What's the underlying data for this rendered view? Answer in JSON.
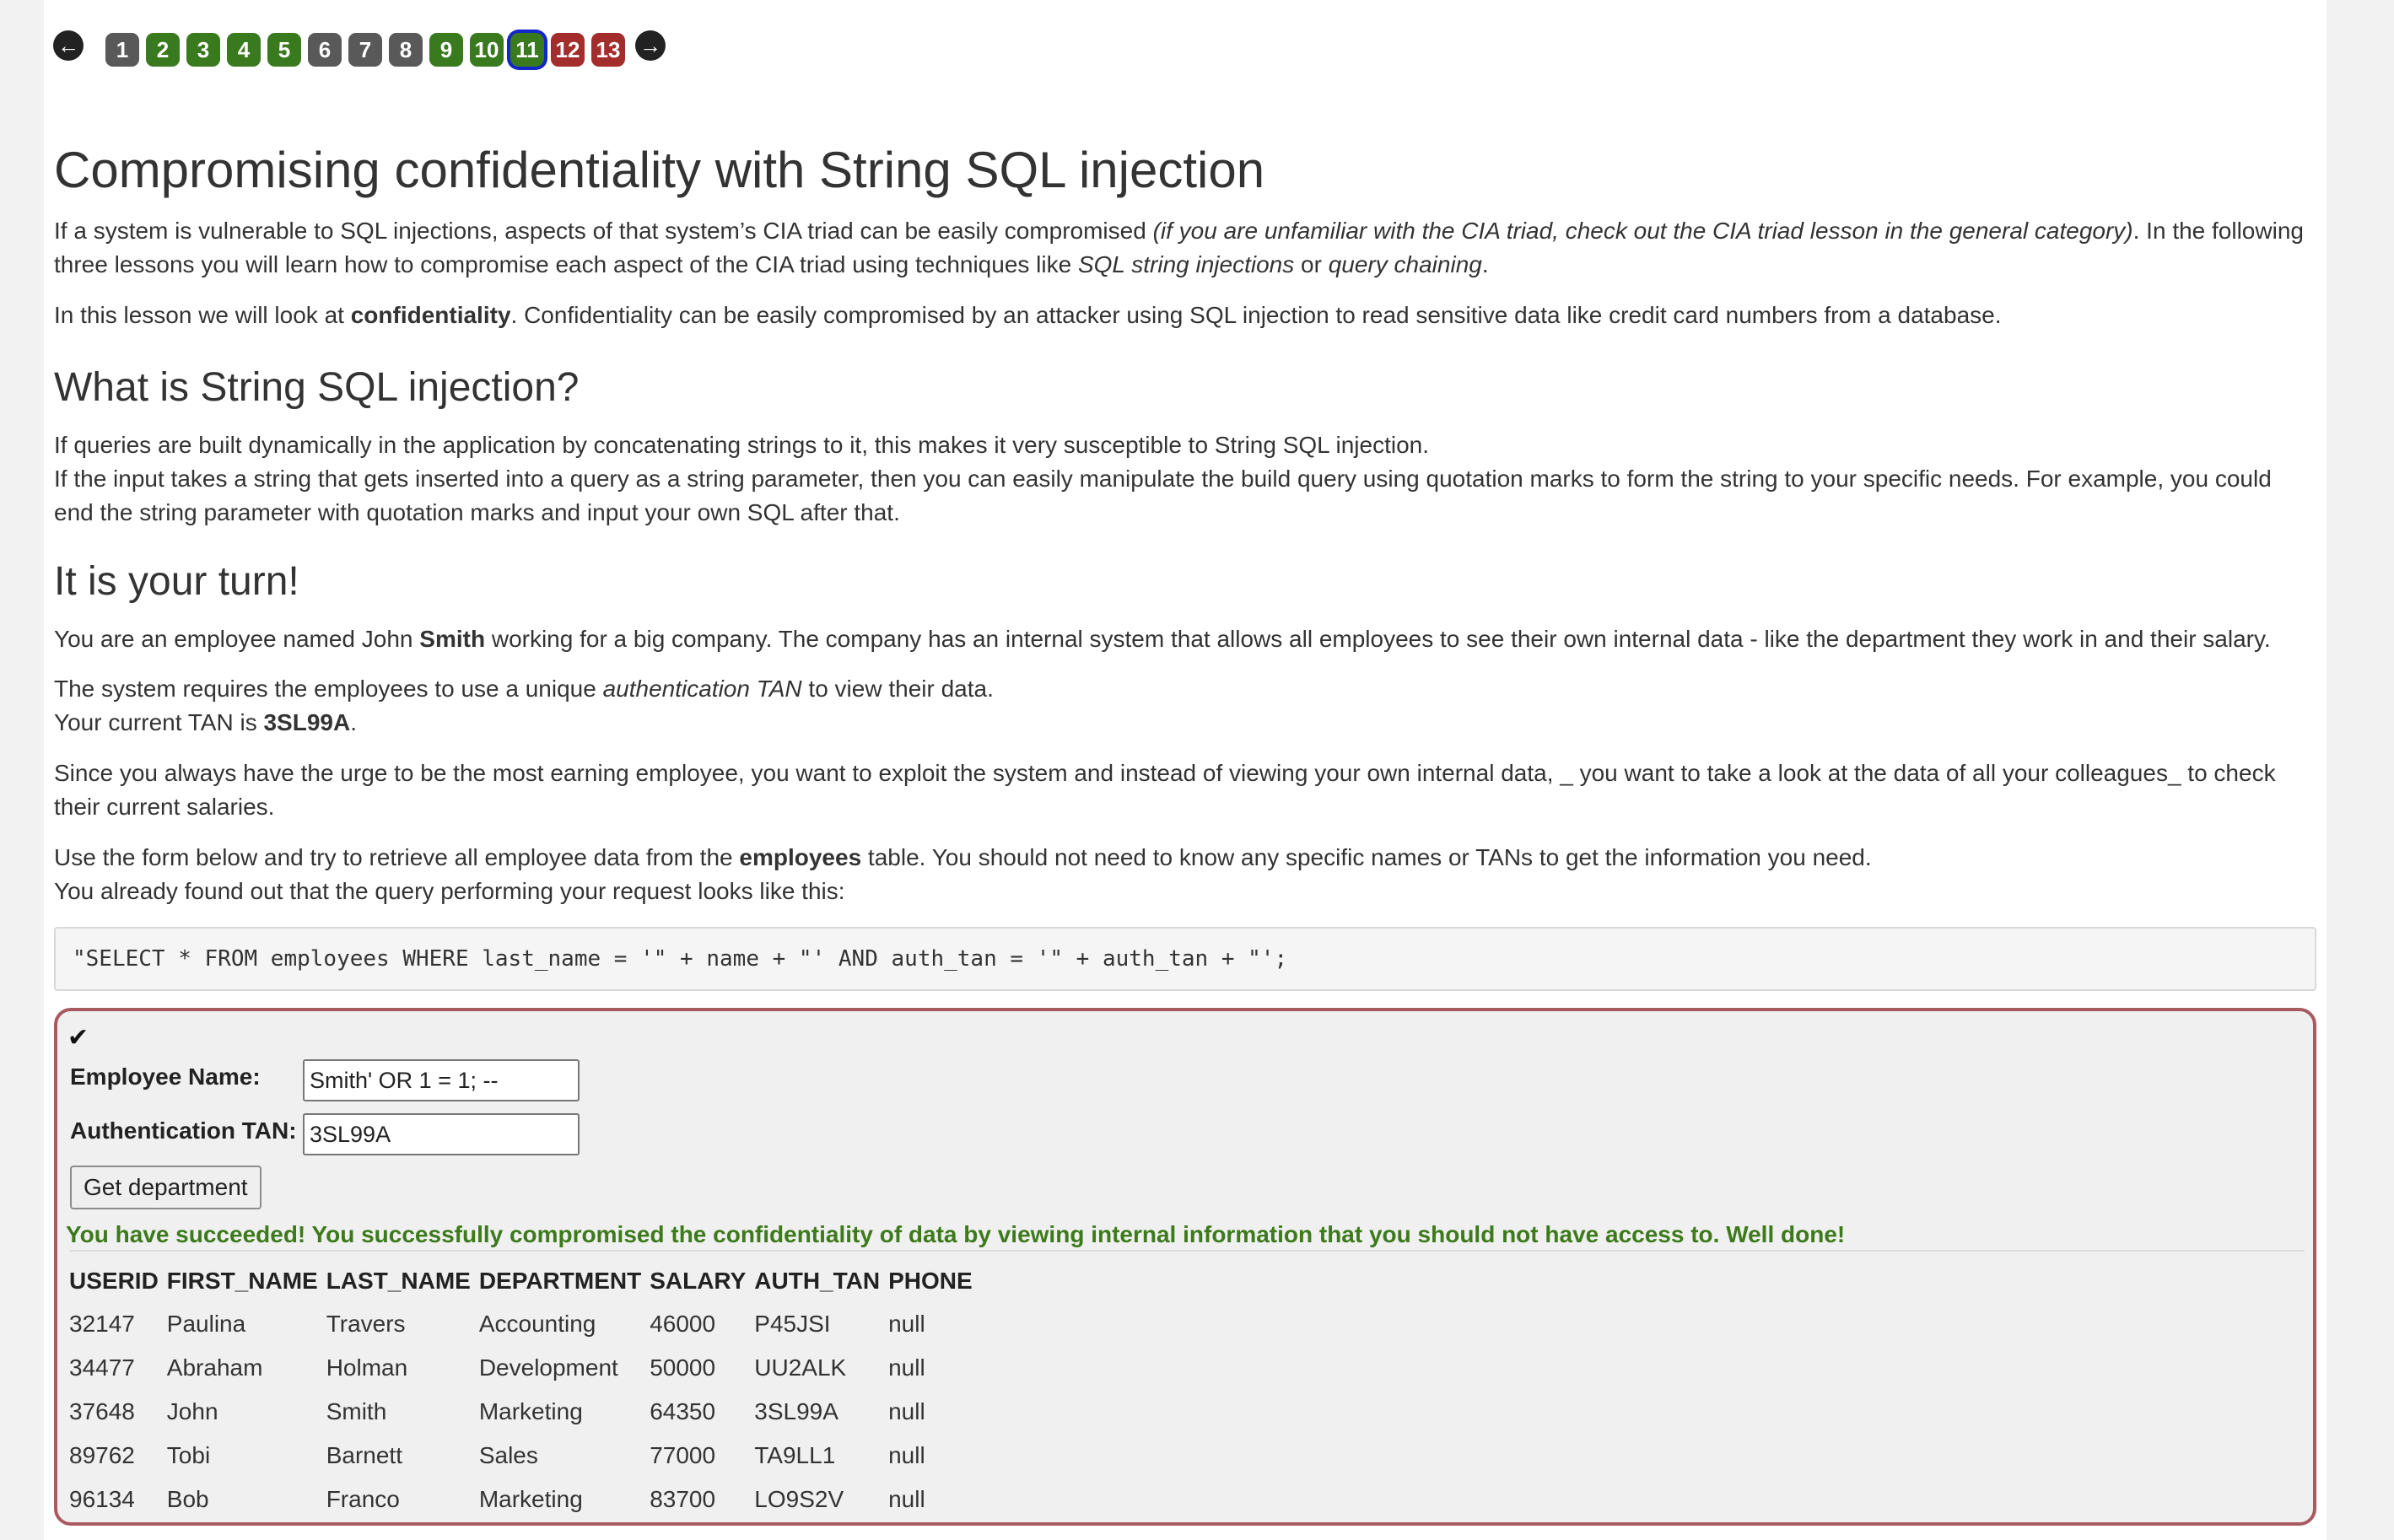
{
  "pager": {
    "prev_icon": "arrow-circle-left-icon",
    "next_icon": "arrow-circle-right-icon",
    "pages": [
      {
        "label": "1",
        "status": "gray"
      },
      {
        "label": "2",
        "status": "green"
      },
      {
        "label": "3",
        "status": "green"
      },
      {
        "label": "4",
        "status": "green"
      },
      {
        "label": "5",
        "status": "green"
      },
      {
        "label": "6",
        "status": "gray"
      },
      {
        "label": "7",
        "status": "gray"
      },
      {
        "label": "8",
        "status": "gray"
      },
      {
        "label": "9",
        "status": "green"
      },
      {
        "label": "10",
        "status": "green"
      },
      {
        "label": "11",
        "status": "green",
        "current": true
      },
      {
        "label": "12",
        "status": "red"
      },
      {
        "label": "13",
        "status": "red"
      }
    ],
    "colors": {
      "gray": "#595959",
      "green": "#3a7a1f",
      "red": "#a32d2d",
      "current_outline": "#1326c7"
    }
  },
  "lesson": {
    "title": "Compromising confidentiality with String SQL injection",
    "p1_a": "If a system is vulnerable to SQL injections, aspects of that system’s CIA triad can be easily compromised ",
    "p1_i": "(if you are unfamiliar with the CIA triad, check out the CIA triad lesson in the general category)",
    "p1_b": ". In the following three lessons you will learn how to compromise each aspect of the CIA triad using techniques like ",
    "p1_i2": "SQL string injections",
    "p1_c": " or ",
    "p1_i3": "query chaining",
    "p1_d": ".",
    "p2_a": "In this lesson we will look at ",
    "p2_b": "confidentiality",
    "p2_c": ". Confidentiality can be easily compromised by an attacker using SQL injection to read sensitive data like credit card numbers from a database.",
    "h2_what": "What is String SQL injection?",
    "p3_line1": "If queries are built dynamically in the application by concatenating strings to it, this makes it very susceptible to String SQL injection.",
    "p3_line2": "If the input takes a string that gets inserted into a query as a string parameter, then you can easily manipulate the build query using quotation marks to form the string to your specific needs. For example, you could end the string parameter with quotation marks and input your own SQL after that.",
    "h2_turn": "It is your turn!",
    "p4_a": "You are an employee named John ",
    "p4_b": "Smith",
    "p4_c": " working for a big company. The company has an internal system that allows all employees to see their own internal data - like the department they work in and their salary.",
    "p5_a": "The system requires the employees to use a unique ",
    "p5_i": "authentication TAN",
    "p5_b": " to view their data.",
    "p5_c": "Your current TAN is ",
    "p5_d": "3SL99A",
    "p5_e": ".",
    "p6": "Since you always have the urge to be the most earning employee, you want to exploit the system and instead of viewing your own internal data, _ you want to take a look at the data of all your colleagues_ to check their current salaries.",
    "p7_a": "Use the form below and try to retrieve all employee data from the ",
    "p7_b": "employees",
    "p7_c": " table. You should not need to know any specific names or TANs to get the information you need.",
    "p7_d": "You already found out that the query performing your request looks like this:",
    "code": "\"SELECT * FROM employees WHERE last_name = '\" + name + \"' AND auth_tan = '\" + auth_tan + \"';"
  },
  "form": {
    "check_icon": "checkmark-icon",
    "name_label": "Employee Name:",
    "name_value": "Smith' OR 1 = 1; --",
    "tan_label": "Authentication TAN:",
    "tan_value": "3SL99A",
    "submit_label": "Get department",
    "success_message": "You have succeeded! You successfully compromised the confidentiality of data by viewing internal information that you should not have access to. Well done!",
    "success_color": "#3c7a1b"
  },
  "table": {
    "headers": [
      "USERID",
      "FIRST_NAME",
      "LAST_NAME",
      "DEPARTMENT",
      "SALARY",
      "AUTH_TAN",
      "PHONE"
    ],
    "rows": [
      [
        "32147",
        "Paulina",
        "Travers",
        "Accounting",
        "46000",
        "P45JSI",
        "null"
      ],
      [
        "34477",
        "Abraham",
        "Holman",
        "Development",
        "50000",
        "UU2ALK",
        "null"
      ],
      [
        "37648",
        "John",
        "Smith",
        "Marketing",
        "64350",
        "3SL99A",
        "null"
      ],
      [
        "89762",
        "Tobi",
        "Barnett",
        "Sales",
        "77000",
        "TA9LL1",
        "null"
      ],
      [
        "96134",
        "Bob",
        "Franco",
        "Marketing",
        "83700",
        "LO9S2V",
        "null"
      ]
    ]
  }
}
